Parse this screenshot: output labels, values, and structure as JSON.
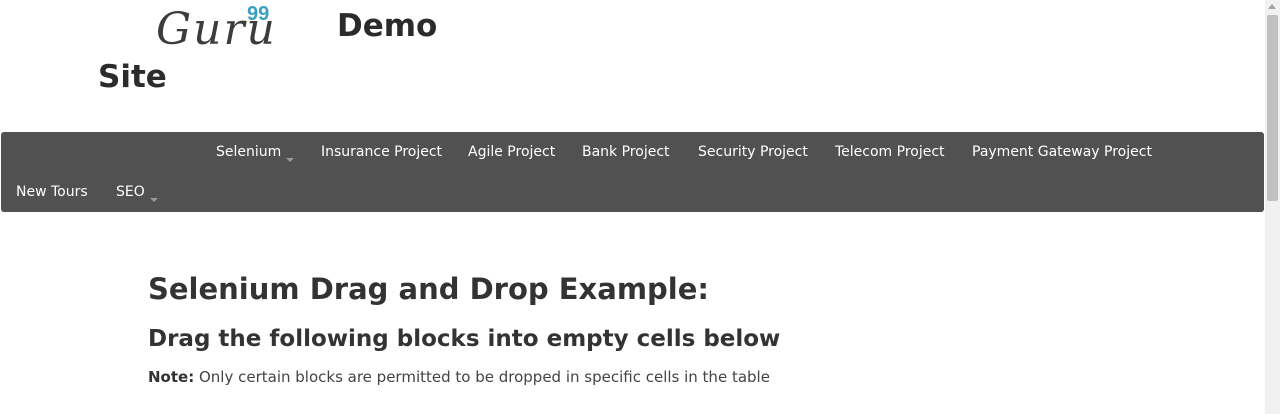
{
  "header": {
    "logo_text": "Guru",
    "logo_sup": "99",
    "title_line1": "Demo",
    "title_line2": "Site"
  },
  "navbar": {
    "items": [
      {
        "label": "Selenium",
        "dropdown": true
      },
      {
        "label": "Insurance Project",
        "dropdown": false
      },
      {
        "label": "Agile Project",
        "dropdown": false
      },
      {
        "label": "Bank Project",
        "dropdown": false
      },
      {
        "label": "Security Project",
        "dropdown": false
      },
      {
        "label": "Telecom Project",
        "dropdown": false
      },
      {
        "label": "Payment Gateway Project",
        "dropdown": false
      },
      {
        "label": "New Tours",
        "dropdown": false
      },
      {
        "label": "SEO",
        "dropdown": true
      }
    ],
    "background_color": "#515151"
  },
  "main": {
    "heading": "Selenium Drag and Drop Example:",
    "subheading": "Drag the following blocks into empty cells below",
    "note_label": "Note:",
    "note_text": "Only certain blocks are permitted to be dropped in specific cells in the table"
  },
  "colors": {
    "accent": "#3aa0c2"
  }
}
